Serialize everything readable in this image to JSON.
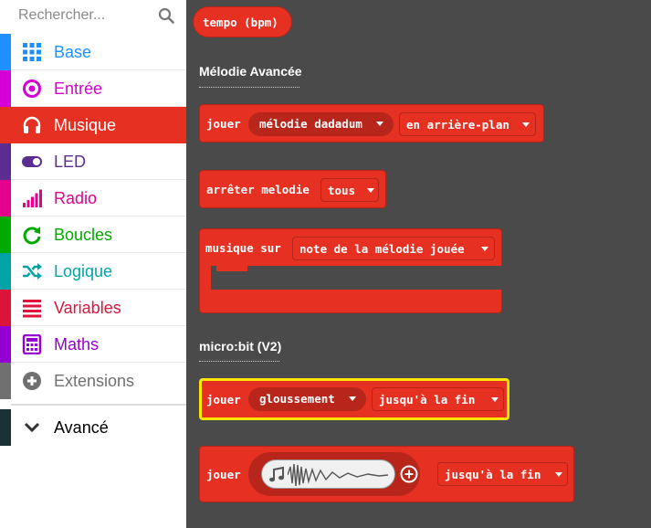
{
  "search": {
    "placeholder": "Rechercher..."
  },
  "categories": [
    {
      "label": "Base",
      "icon": "grid-icon",
      "color": "#1e90ff"
    },
    {
      "label": "Entrée",
      "icon": "circle-dot-icon",
      "color": "#d400d4"
    },
    {
      "label": "Musique",
      "icon": "headphones-icon",
      "color": "#e63022",
      "selected": true
    },
    {
      "label": "LED",
      "icon": "toggle-icon",
      "color": "#5c2d91"
    },
    {
      "label": "Radio",
      "icon": "signal-bars-icon",
      "color": "#e3008c"
    },
    {
      "label": "Boucles",
      "icon": "refresh-icon",
      "color": "#00aa00"
    },
    {
      "label": "Logique",
      "icon": "shuffle-icon",
      "color": "#00a4a6"
    },
    {
      "label": "Variables",
      "icon": "lines-icon",
      "color": "#dc143c"
    },
    {
      "label": "Maths",
      "icon": "calculator-icon",
      "color": "#9400d3"
    },
    {
      "label": "Extensions",
      "icon": "plus-circle-icon",
      "color": "#707070"
    },
    {
      "label": "Avancé",
      "icon": "chevron-down-icon",
      "color": "#000000"
    }
  ],
  "workspace": {
    "tempo": "tempo (bpm)",
    "section1": "Mélodie Avancée",
    "block_play": {
      "word": "jouer",
      "melody": "mélodie dadadum",
      "mode": "en arrière-plan"
    },
    "block_stop": {
      "word": "arrêter melodie",
      "option": "tous"
    },
    "block_on": {
      "word": "musique sur",
      "event": "note de la mélodie jouée"
    },
    "section2": "micro:bit (V2)",
    "block_sound": {
      "word": "jouer",
      "sound": "gloussement",
      "mode": "jusqu'à la fin"
    },
    "block_custom": {
      "word": "jouer",
      "mode": "jusqu'à la fin"
    }
  }
}
